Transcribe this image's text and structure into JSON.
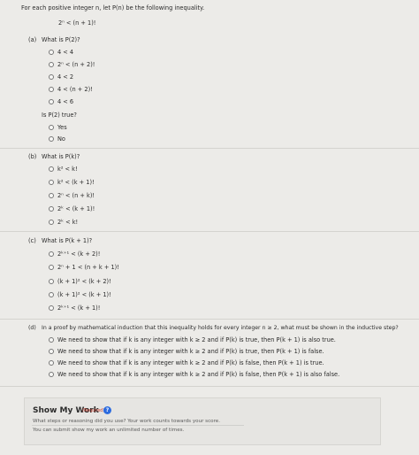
{
  "intro": {
    "text": "For each positive integer n, let P(n) be the following inequality.",
    "inequality": "2ⁿ < (n + 1)!"
  },
  "part_a": {
    "label": "(a)",
    "question": "What is P(2)?",
    "options": [
      "4 < 4",
      "2ⁿ < (n + 2)!",
      "4 < 2",
      "4 < (n + 2)!",
      "4 < 6"
    ],
    "followup": "Is P(2) true?",
    "yes": "Yes",
    "no": "No"
  },
  "part_b": {
    "label": "(b)",
    "question": "What is P(k)?",
    "options": [
      "k² < k!",
      "k² < (k + 1)!",
      "2ⁿ < (n + k)!",
      "2ᵏ < (k + 1)!",
      "2ᵏ < k!"
    ]
  },
  "part_c": {
    "label": "(c)",
    "question": "What is P(k + 1)?",
    "options": [
      "2ᵏ⁺¹ < (k + 2)!",
      "2ⁿ + 1 < (n + k + 1)!",
      "(k + 1)² < (k + 2)!",
      "(k + 1)² < (k + 1)!",
      "2ᵏ⁺¹ < (k + 1)!"
    ]
  },
  "part_d": {
    "label": "(d)",
    "question": "In a proof by mathematical induction that this inequality holds for every integer n ≥ 2, what must be shown in the inductive step?",
    "options": [
      "We need to show that if k is any integer with k ≥ 2 and if P(k) is true, then P(k + 1) is also true.",
      "We need to show that if k is any integer with k ≥ 2 and if P(k) is true, then P(k + 1) is false.",
      "We need to show that if k is any integer with k ≥ 2 and if P(k) is false, then P(k + 1) is true.",
      "We need to show that if k is any integer with k ≥ 2 and if P(k) is false, then P(k + 1) is also false."
    ]
  },
  "show_work": {
    "title": "Show My Work",
    "required": "(Required)",
    "help_icon": "question-circle-icon",
    "line1": "What steps or reasoning did you use? Your work counts towards your score.",
    "line2": "You can submit show my work an unlimited number of times."
  },
  "colors": {
    "background": "#ecebe8",
    "help_icon": "#2d6cdf",
    "required_text": "#c0392b"
  }
}
